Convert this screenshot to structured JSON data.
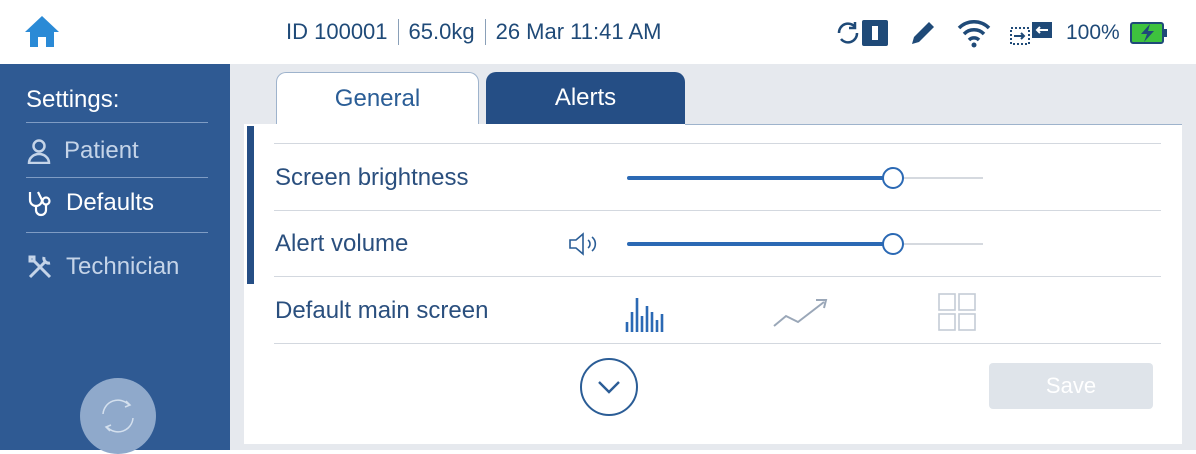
{
  "status_bar": {
    "patient_id": "ID 100001",
    "weight": "65.0kg",
    "datetime": "26 Mar 11:41 AM",
    "icons": [
      "sync-device-icon",
      "pencil-icon",
      "wifi-icon",
      "transfer-icon",
      "battery-charging-icon"
    ],
    "battery_percent": "100%"
  },
  "sidebar": {
    "title": "Settings:",
    "items": [
      {
        "label": "Patient",
        "icon": "person-icon",
        "active": false
      },
      {
        "label": "Defaults",
        "icon": "stethoscope-icon",
        "active": true
      },
      {
        "label": "Technician",
        "icon": "tools-icon",
        "active": false
      }
    ]
  },
  "tabs": [
    {
      "label": "General",
      "selected": true
    },
    {
      "label": "Alerts",
      "selected": false
    }
  ],
  "settings": {
    "brightness": {
      "label": "Screen brightness",
      "level": 0.75
    },
    "volume": {
      "label": "Alert volume",
      "level": 0.75,
      "icon": "speaker-icon"
    },
    "main_screen": {
      "label": "Default main screen",
      "options": [
        {
          "icon": "bar-chart-icon",
          "selected": true
        },
        {
          "icon": "trend-line-icon",
          "selected": false
        },
        {
          "icon": "grid-icon",
          "selected": false
        }
      ]
    }
  },
  "actions": {
    "save_label": "Save",
    "save_enabled": false
  },
  "colors": {
    "primary": "#254e85",
    "sidebar": "#2f5a93",
    "accent": "#2b69b4",
    "battery_green": "#3ec23e"
  }
}
